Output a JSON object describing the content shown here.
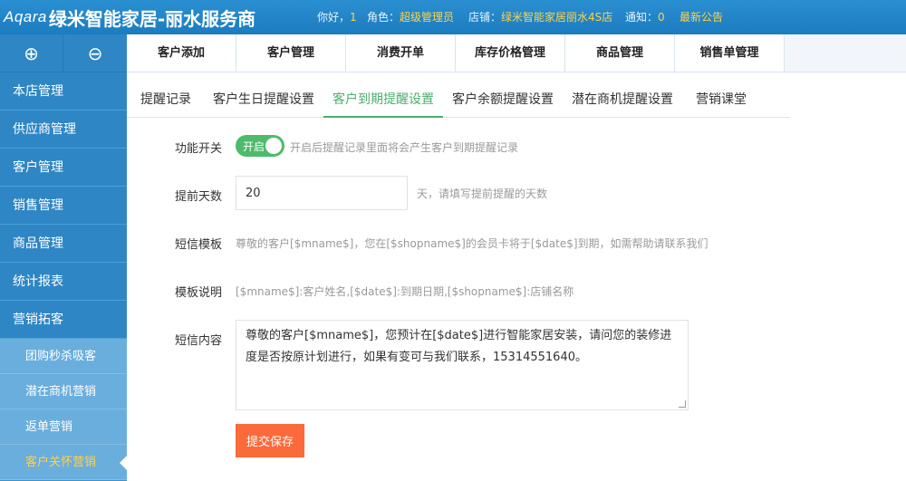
{
  "header": {
    "brand": "Aqara",
    "title": "绿米智能家居-丽水服务商",
    "greeting_label": "你好，",
    "greeting_value": "1",
    "role_label": "角色：",
    "role_value": "超级管理员",
    "shop_label": "店铺：",
    "shop_value": "绿米智能家居丽水4S店",
    "notice_label": "通知：",
    "notice_value": "0",
    "announcement": "最新公告"
  },
  "sidebar": {
    "tools": [
      "⊕",
      "⊖"
    ],
    "items": [
      "本店管理",
      "供应商管理",
      "客户管理",
      "销售管理",
      "商品管理",
      "统计报表",
      "营销拓客"
    ],
    "sub_items": [
      "团购秒杀吸客",
      "潜在商机营销",
      "返单营销",
      "客户关怀营销"
    ],
    "active_sub": "客户关怀营销"
  },
  "topnav": [
    "客户添加",
    "客户管理",
    "消费开单",
    "库存价格管理",
    "商品管理",
    "销售单管理"
  ],
  "subtabs": [
    "提醒记录",
    "客户生日提醒设置",
    "客户到期提醒设置",
    "客户余额提醒设置",
    "潜在商机提醒设置",
    "营销课堂"
  ],
  "form": {
    "switch_label": "功能开关",
    "switch_text": "开启",
    "switch_hint": "开启后提醒记录里面将会产生客户到期提醒记录",
    "days_label": "提前天数",
    "days_value": "20",
    "days_hint": "天，请填写提前提醒的天数",
    "template_label": "短信模板",
    "template_value": "尊敬的客户[$mname$]，您在[$shopname$]的会员卡将于[$date$]到期，如需帮助请联系我们",
    "template_desc_label": "模板说明",
    "template_desc_value": "[$mname$]:客户姓名,[$date$]:到期日期,[$shopname$]:店铺名称",
    "content_label": "短信内容",
    "content_value": "尊敬的客户[$mname$]，您预计在[$date$]进行智能家居安装，请问您的装修进度是否按原计划进行，如果有变可与我们联系，15314551640。",
    "submit_label": "提交保存"
  },
  "colors": {
    "header_bg": "#1c7cc0",
    "sidebar_bg": "#2f86c4",
    "accent_green": "#4cae6e",
    "submit_orange": "#fa6a3a",
    "highlight_yellow": "#ffd24a"
  }
}
